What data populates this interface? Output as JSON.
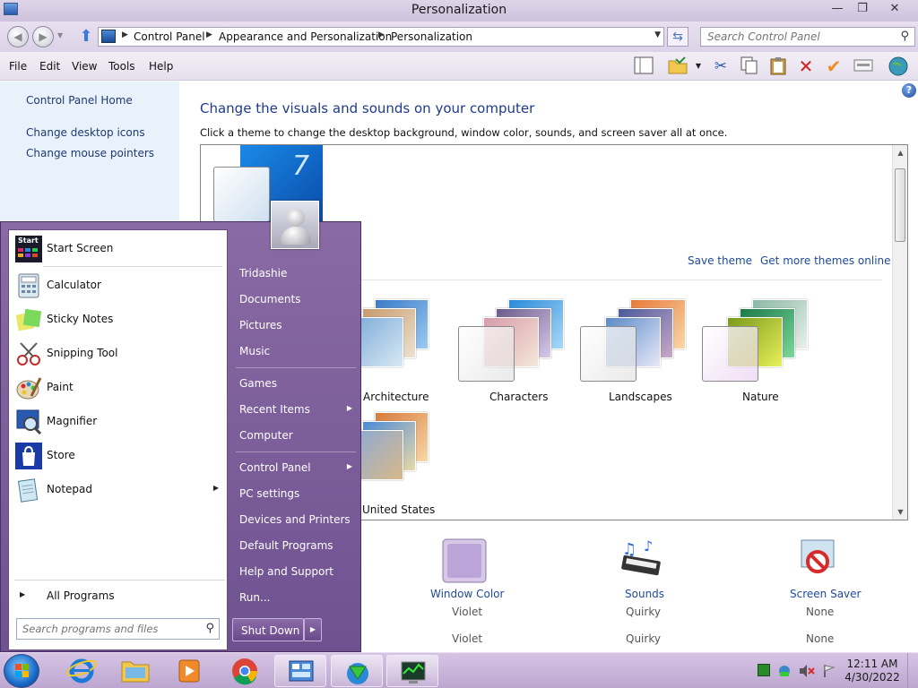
{
  "window": {
    "title": "Personalization",
    "minimize": "—",
    "maximize": "❐",
    "close": "✕"
  },
  "address": {
    "crumbs": [
      "Control Panel",
      "Appearance and Personalization",
      "Personalization"
    ],
    "search_placeholder": "Search Control Panel"
  },
  "menu": [
    "File",
    "Edit",
    "View",
    "Tools",
    "Help"
  ],
  "left_pane": {
    "links": [
      "Control Panel Home",
      "Change desktop icons",
      "Change mouse pointers"
    ]
  },
  "main": {
    "heading": "Change the visuals and sounds on your computer",
    "subheading": "Click a theme to change the desktop background, window color, sounds, and screen saver all at once.",
    "save_theme": "Save theme",
    "get_more_themes": "Get more themes online",
    "themes": [
      "Architecture",
      "Characters",
      "Landscapes",
      "Nature",
      "United States"
    ],
    "settings": [
      {
        "label": "Window Color",
        "value": "Violet"
      },
      {
        "label": "Sounds",
        "value": "Quirky"
      },
      {
        "label": "Screen Saver",
        "value": "None"
      }
    ]
  },
  "start_menu": {
    "left_items": [
      "Start Screen",
      "Calculator",
      "Sticky Notes",
      "Snipping Tool",
      "Paint",
      "Magnifier",
      "Store",
      "Notepad"
    ],
    "start_badge": "Start",
    "all_programs": "All Programs",
    "search_placeholder": "Search programs and files",
    "right_items": [
      "Tridashie",
      "Documents",
      "Pictures",
      "Music",
      "Games",
      "Recent Items",
      "Computer",
      "Control Panel",
      "PC settings",
      "Devices and Printers",
      "Default Programs",
      "Help and Support",
      "Run..."
    ],
    "shutdown": "Shut Down"
  },
  "taskbar": {
    "time": "12:11 AM",
    "date": "4/30/2022"
  }
}
